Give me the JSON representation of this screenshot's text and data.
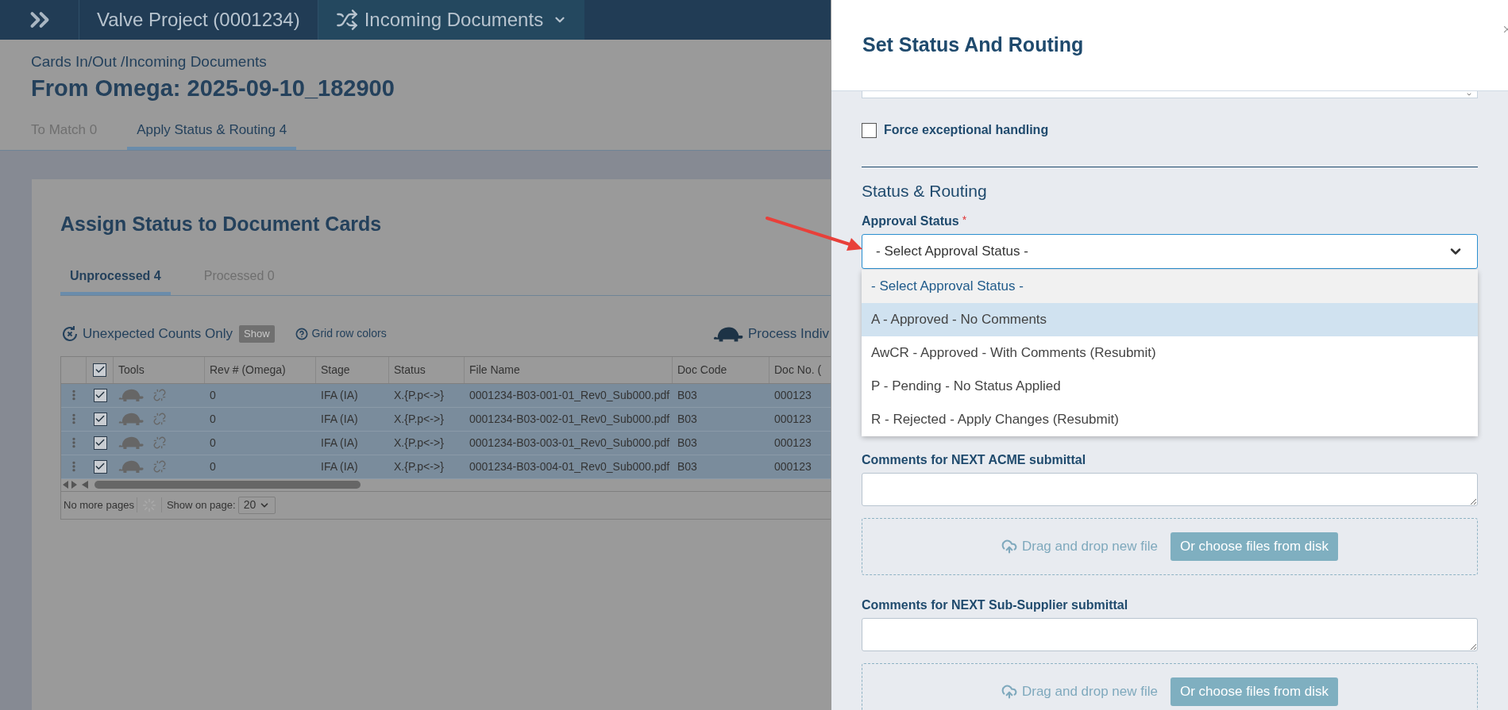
{
  "top_bar": {
    "project": "Valve Project (0001234)",
    "module": "Incoming Documents"
  },
  "breadcrumb": "Cards In/Out /Incoming Documents",
  "page_title": "From Omega: 2025-09-10_182900",
  "tabs": [
    {
      "label": "To Match 0",
      "selected": false
    },
    {
      "label": "Apply Status & Routing 4",
      "selected": true
    }
  ],
  "card": {
    "title": "Assign Status to Document Cards",
    "tabs": [
      {
        "label": "Unprocessed 4",
        "selected": true
      },
      {
        "label": "Processed 0",
        "selected": false
      }
    ],
    "toolbar": {
      "unexpected_label": "Unexpected Counts Only",
      "show_button": "Show",
      "grid_colors": "Grid row colors",
      "process": "Process Indiv"
    },
    "table": {
      "header_checked": true,
      "tools_column": "Tools",
      "columns": [
        "Rev # (Omega)",
        "Stage",
        "Status",
        "File Name",
        "Doc Code",
        "Doc No. ("
      ],
      "rows": [
        {
          "checked": true,
          "cells": [
            "0",
            "IFA (IA)",
            "X.{P.p<->}",
            "0001234-B03-001-01_Rev0_Sub000.pdf",
            "B03",
            "000123"
          ]
        },
        {
          "checked": true,
          "cells": [
            "0",
            "IFA (IA)",
            "X.{P.p<->}",
            "0001234-B03-002-01_Rev0_Sub000.pdf",
            "B03",
            "000123"
          ]
        },
        {
          "checked": true,
          "cells": [
            "0",
            "IFA (IA)",
            "X.{P.p<->}",
            "0001234-B03-003-01_Rev0_Sub000.pdf",
            "B03",
            "000123"
          ]
        },
        {
          "checked": true,
          "cells": [
            "0",
            "IFA (IA)",
            "X.{P.p<->}",
            "0001234-B03-004-01_Rev0_Sub000.pdf",
            "B03",
            "000123"
          ]
        }
      ]
    },
    "footer": {
      "pages": "No more pages",
      "show_on_page_label": "Show on page:",
      "page_size": "20"
    }
  },
  "panel": {
    "title": "Set Status And Routing",
    "force_checkbox": {
      "label": "Force exceptional handling",
      "checked": false
    },
    "section_title": "Status & Routing",
    "approval": {
      "label": "Approval Status",
      "required_mark": "*",
      "value": "- Select Approval Status -",
      "expanded": true,
      "options": [
        {
          "label": "- Select Approval Status -",
          "selected": true,
          "highlighted": false
        },
        {
          "label": "A - Approved - No Comments",
          "selected": false,
          "highlighted": true
        },
        {
          "label": "AwCR - Approved - With Comments (Resubmit)",
          "selected": false,
          "highlighted": false
        },
        {
          "label": "P - Pending - No Status Applied",
          "selected": false,
          "highlighted": false
        },
        {
          "label": "R - Rejected - Apply Changes (Resubmit)",
          "selected": false,
          "highlighted": false
        }
      ]
    },
    "comments": [
      {
        "label": "Comments for NEXT ACME submittal",
        "drop_text": "Drag and drop new file",
        "button": "Or choose files from disk"
      },
      {
        "label": "Comments for NEXT Sub-Supplier submittal",
        "drop_text": "Drag and drop new file",
        "button": "Or choose files from disk"
      }
    ]
  }
}
